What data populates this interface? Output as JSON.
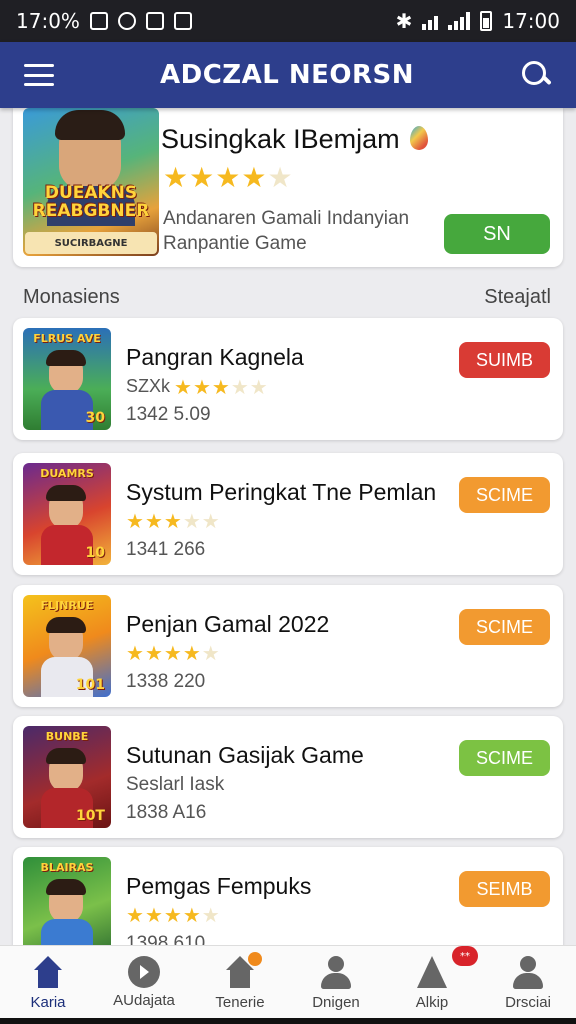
{
  "status_bar": {
    "left_text": "17:0%",
    "time": "17:00"
  },
  "app_bar": {
    "title": "ADCZAL NEORSN"
  },
  "featured": {
    "title": "Susingkak IBemjam",
    "rating": 4,
    "thumb_logo": "DUEAKNS REABGBNER",
    "thumb_banner": "SUCIRBAGNE",
    "subtitle_line1": "Andanaren Gamali Indanyian",
    "subtitle_line2": "Ranpantie Game",
    "button_label": "SN",
    "button_color": "#46a83d"
  },
  "section": {
    "left_label": "Monasiens",
    "right_label": "Steajatl"
  },
  "games": [
    {
      "title": "Pangran Kagnela",
      "rating_label": "SZXk",
      "rating": 3,
      "count": "1342 5.09",
      "button_label": "SUIMB",
      "button_color": "#d93b34",
      "thumb_logo": "FLRUS AVE",
      "thumb_num": "30",
      "thumb_bg": "linear-gradient(180deg,#2b6fb8 0%,#4bae57 60%,#2f7d32 100%)",
      "thumb_body": "#3a59b0"
    },
    {
      "title": "Systum Peringkat Tne Pemlan",
      "rating": 3.5,
      "count": "1341 266",
      "button_label": "SCIME",
      "button_color": "#f29a30",
      "thumb_logo": "DUAMRS",
      "thumb_num": "10",
      "thumb_bg": "linear-gradient(160deg,#6a2a8f 0%,#d8442e 55%,#f2b33a 100%)",
      "thumb_body": "#c3272d"
    },
    {
      "title": "Penjan Gamal 2022",
      "rating": 4,
      "count": "1338 220",
      "button_label": "SCIME",
      "button_color": "#f29a30",
      "thumb_logo": "FLJNRUE",
      "thumb_num": "101",
      "thumb_bg": "linear-gradient(160deg,#f4c21c 0%,#f08a1c 50%,#3f6fcf 100%)",
      "thumb_body": "#e9e9ef"
    },
    {
      "title": "Sutunan Gasijak Game",
      "subtitle": "Seslarl Iask",
      "count": "1838 A16",
      "button_label": "SCIME",
      "button_color": "#7cc243",
      "thumb_logo": "BUNBE",
      "thumb_num": "10T",
      "thumb_bg": "linear-gradient(160deg,#4a2a6a 0%,#a32b2b 60%,#6b1414 100%)",
      "thumb_body": "#b3262a"
    },
    {
      "title": "Pemgas Fempuks",
      "rating": 4,
      "count": "1398 610",
      "button_label": "SEIMB",
      "button_color": "#f29a30",
      "thumb_logo": "BLAIRAS",
      "thumb_num": "",
      "thumb_bg": "linear-gradient(160deg,#2f8f3a 0%,#7bc04a 55%,#2a6a2f 100%)",
      "thumb_body": "#3b7bd1"
    }
  ],
  "bottom_nav": [
    {
      "label": "Karia",
      "icon": "home-icon",
      "active": true
    },
    {
      "label": "AUdajata",
      "icon": "play-circle-icon"
    },
    {
      "label": "Tenerie",
      "icon": "store-icon"
    },
    {
      "label": "Dnigen",
      "icon": "profile-icon"
    },
    {
      "label": "Alkip",
      "icon": "alert-icon",
      "badge": "**"
    },
    {
      "label": "Drsciai",
      "icon": "account-icon"
    }
  ]
}
